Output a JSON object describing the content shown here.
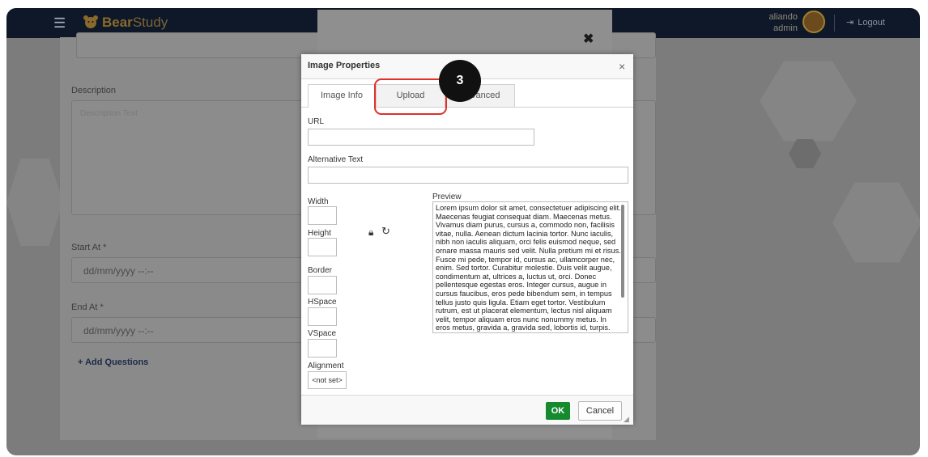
{
  "app": {
    "brand_part1": "Bear",
    "brand_part2": "Study",
    "menu_icon": "hamburger-icon",
    "logo_icon": "bear-logo-icon"
  },
  "user": {
    "name": "aliando",
    "role": "admin",
    "logout_label": "Logout",
    "logout_icon": "logout-icon"
  },
  "form": {
    "description_label": "Description",
    "description_placeholder": "Description Text",
    "start_label": "Start At *",
    "start_placeholder": "dd/mm/yyyy --:--",
    "end_label": "End At *",
    "end_placeholder": "dd/mm/yyyy --:--",
    "add_questions": "+ Add Questions"
  },
  "background_modal": {
    "close": "✖"
  },
  "dialog": {
    "title": "Image Properties",
    "close": "×",
    "tabs": [
      "Image Info",
      "Upload",
      "Advanced"
    ],
    "url_label": "URL",
    "url_value": "",
    "alt_label": "Alternative Text",
    "alt_value": "",
    "width_label": "Width",
    "height_label": "Height",
    "border_label": "Border",
    "hspace_label": "HSpace",
    "vspace_label": "VSpace",
    "alignment_label": "Alignment",
    "alignment_value": "<not set>",
    "preview_label": "Preview",
    "preview_text": "Lorem ipsum dolor sit amet, consectetuer adipiscing elit. Maecenas feugiat consequat diam. Maecenas metus. Vivamus diam purus, cursus a, commodo non, facilisis vitae, nulla. Aenean dictum lacinia tortor. Nunc iaculis, nibh non iaculis aliquam, orci felis euismod neque, sed ornare massa mauris sed velit. Nulla pretium mi et risus. Fusce mi pede, tempor id, cursus ac, ullamcorper nec, enim. Sed tortor. Curabitur molestie. Duis velit augue, condimentum at, ultrices a, luctus ut, orci. Donec pellentesque egestas eros. Integer cursus, augue in cursus faucibus, eros pede bibendum sem, in tempus tellus justo quis ligula. Etiam eget tortor. Vestibulum rutrum, est ut placerat elementum, lectus nisl aliquam velit, tempor aliquam eros nunc nonummy metus. In eros metus, gravida a, gravida sed, lobortis id, turpis.",
    "ok_label": "OK",
    "cancel_label": "Cancel",
    "lock_icon": "lock-icon",
    "reset_icon": "reset-size-icon"
  },
  "annotation": {
    "step_number": "3",
    "highlight_color": "#e0302a"
  },
  "colors": {
    "topbar": "#0f1828",
    "brand": "#8a6a2c",
    "ok_button": "#168a2e"
  }
}
